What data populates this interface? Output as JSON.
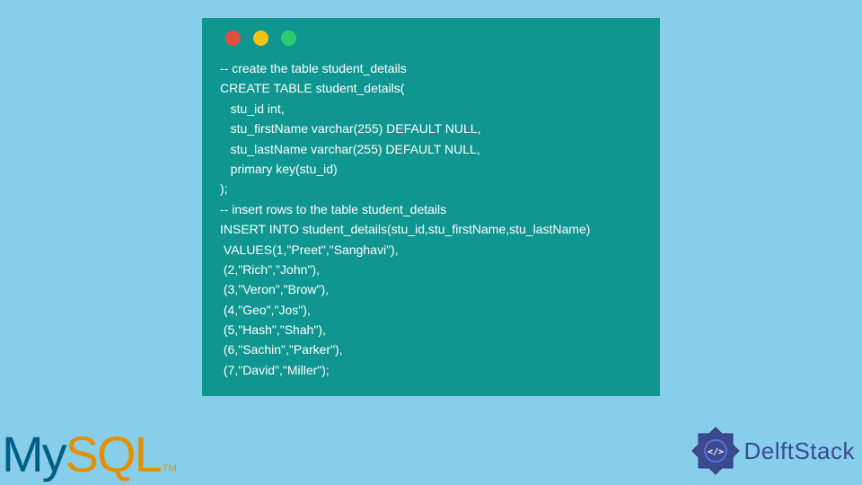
{
  "code": {
    "lines": [
      "-- create the table student_details",
      "CREATE TABLE student_details(",
      "   stu_id int,",
      "   stu_firstName varchar(255) DEFAULT NULL,",
      "   stu_lastName varchar(255) DEFAULT NULL,",
      "   primary key(stu_id)",
      ");",
      "-- insert rows to the table student_details",
      "INSERT INTO student_details(stu_id,stu_firstName,stu_lastName)",
      " VALUES(1,\"Preet\",\"Sanghavi\"),",
      " (2,\"Rich\",\"John\"),",
      " (3,\"Veron\",\"Brow\"),",
      " (4,\"Geo\",\"Jos\"),",
      " (5,\"Hash\",\"Shah\"),",
      " (6,\"Sachin\",\"Parker\"),",
      " (7,\"David\",\"Miller\");"
    ]
  },
  "logos": {
    "mysql": {
      "my": "My",
      "sql": "SQL",
      "tm": "TM"
    },
    "delftstack": {
      "text": "DelftStack",
      "badge_symbol": "</>"
    }
  },
  "colors": {
    "page_bg": "#87CEEB",
    "window_bg": "#0F9690",
    "code_text": "#FFFFFF",
    "mysql_my": "#005E86",
    "mysql_sql": "#E48E00",
    "delft_text": "#3B4A8F"
  }
}
